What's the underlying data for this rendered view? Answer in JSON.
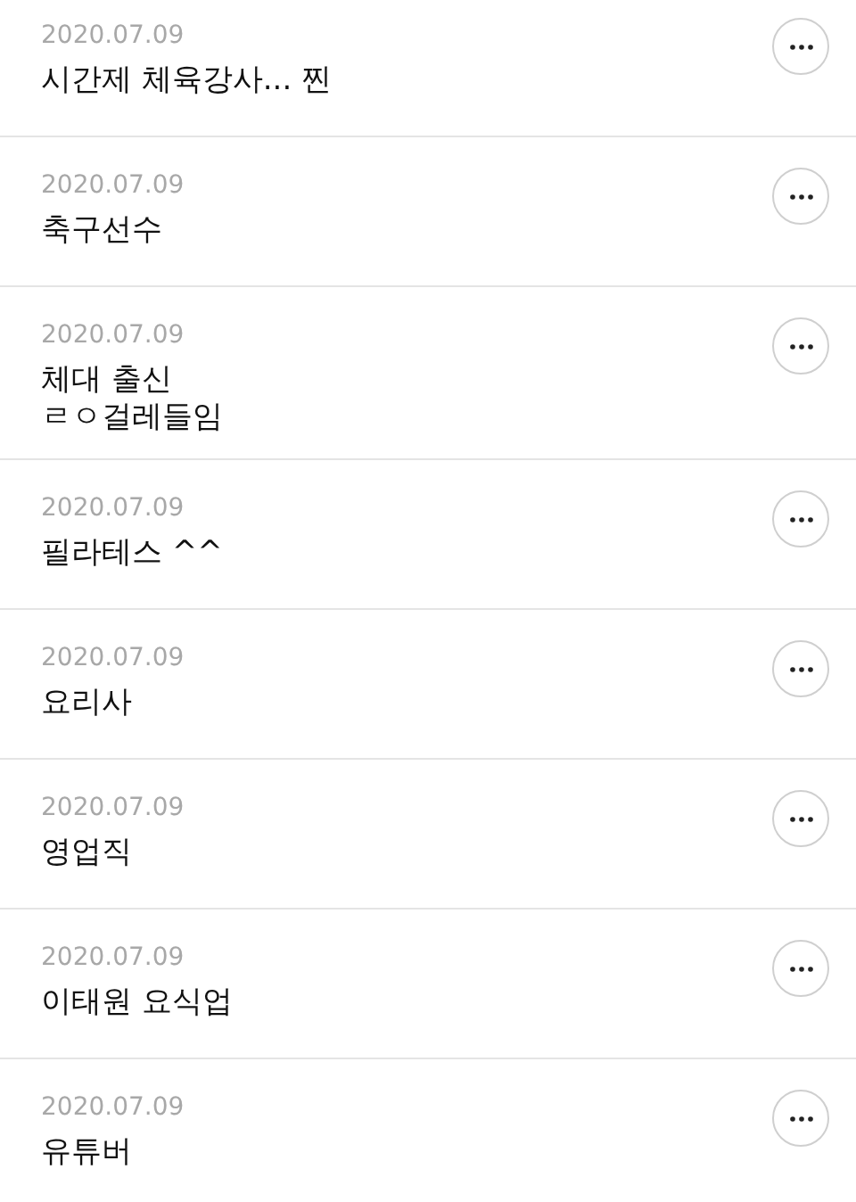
{
  "posts": [
    {
      "date": "2020.07.09",
      "text": "시간제 체육강사... 찐"
    },
    {
      "date": "2020.07.09",
      "text": "축구선수"
    },
    {
      "date": "2020.07.09",
      "text": "체대 출신\nㄹㅇ걸레들임"
    },
    {
      "date": "2020.07.09",
      "text": "필라테스 ^^"
    },
    {
      "date": "2020.07.09",
      "text": "요리사"
    },
    {
      "date": "2020.07.09",
      "text": "영업직"
    },
    {
      "date": "2020.07.09",
      "text": "이태원 요식업"
    },
    {
      "date": "2020.07.09",
      "text": "유튜버"
    }
  ]
}
